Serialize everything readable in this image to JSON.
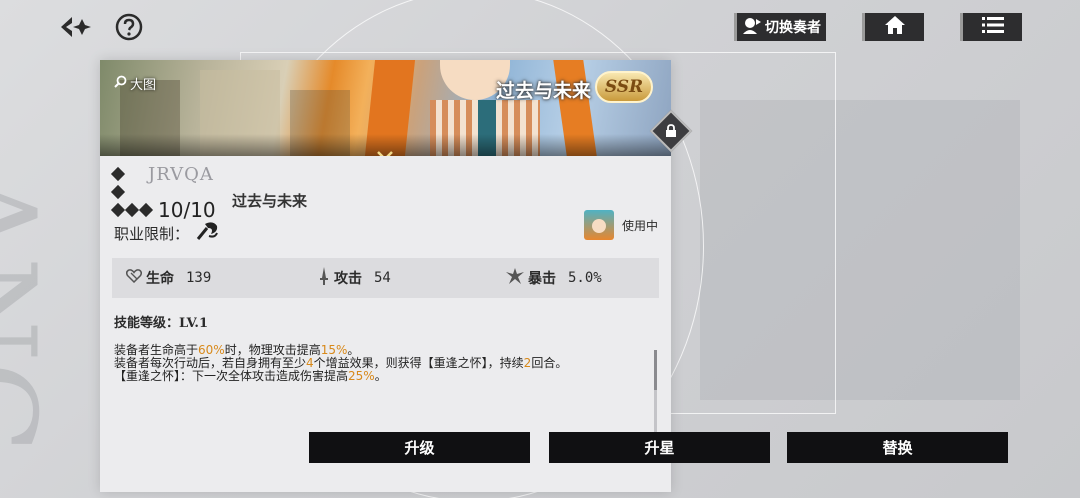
{
  "topbar": {
    "switch_label": "切换奏者"
  },
  "card": {
    "enlarge_label": "大图",
    "banner_title": "过去与未来",
    "rarity_badge": "SSR",
    "logo_text": "JRVQA",
    "level": "10/10",
    "name": "过去与未来",
    "job_label": "职业限制：",
    "in_use_label": "使用中",
    "stats": [
      {
        "label": "生命",
        "value": "139",
        "icon": "heart-icon"
      },
      {
        "label": "攻击",
        "value": "54",
        "icon": "sword-icon"
      },
      {
        "label": "暴击",
        "value": "5.0%",
        "icon": "crit-icon"
      }
    ],
    "skill_level": "技能等级：LV.1",
    "desc": {
      "l1a": "装备者生命高于",
      "l1b": "60%",
      "l1c": "时，物理攻击提高",
      "l1d": "15%",
      "l1e": "。",
      "l2a": "装备者每次行动后，若自身拥有至少",
      "l2b": "4",
      "l2c": "个增益效果，则获得【重逢之怀】，持续",
      "l2d": "2",
      "l2e": "回合。",
      "l3a": "【重逢之怀】：下一次全体攻击造成伤害提高",
      "l3b": "25%",
      "l3c": "。"
    }
  },
  "actions": {
    "upgrade": "升级",
    "star_up": "升星",
    "replace": "替换"
  },
  "colors": {
    "highlight": "#d8891a",
    "button_bg": "#101012"
  }
}
